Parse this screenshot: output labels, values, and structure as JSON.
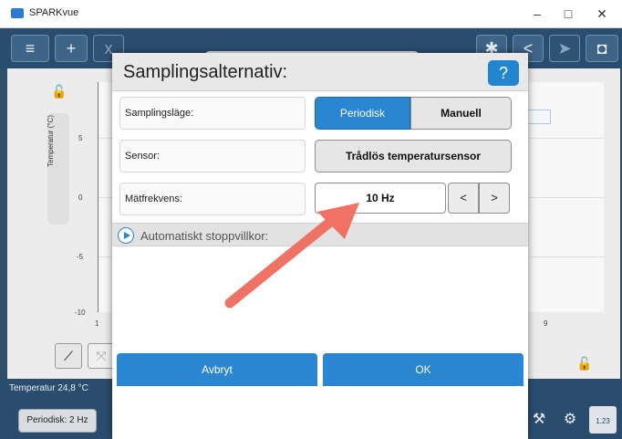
{
  "window": {
    "title": "SPARKvue",
    "minimize": "–",
    "maximize": "□",
    "close": "✕"
  },
  "toolbar": {
    "menu_icon": "≡",
    "add_icon": "+",
    "file_icon": "x",
    "bluetooth_icon": "✱",
    "share_icon": "<",
    "export_icon": "➤",
    "camera_icon": "◘"
  },
  "graph": {
    "ylabel": "Temperatur (°C)",
    "yticks": [
      "5",
      "0",
      "-5",
      "-10"
    ],
    "xticks": [
      "1",
      "9"
    ],
    "lock": "🔓"
  },
  "status": {
    "reading": "Temperatur  24,8 °C"
  },
  "bottom": {
    "rate": "Periodisk: 2 Hz",
    "counter": "1.23"
  },
  "dialog": {
    "title": "Samplingsalternativ:",
    "help": "?",
    "rows": {
      "mode_label": "Samplingsläge:",
      "mode_option_1": "Periodisk",
      "mode_option_2": "Manuell",
      "sensor_label": "Sensor:",
      "sensor_value": "Trådlös temperatursensor",
      "freq_label": "Mätfrekvens:",
      "freq_value": "10 Hz",
      "freq_prev": "<",
      "freq_next": ">"
    },
    "section": "Automatiskt stoppvillkor:",
    "cancel": "Avbryt",
    "ok": "OK"
  },
  "colors": {
    "accent": "#2a86d0",
    "annotation_arrow": "#f07264"
  }
}
